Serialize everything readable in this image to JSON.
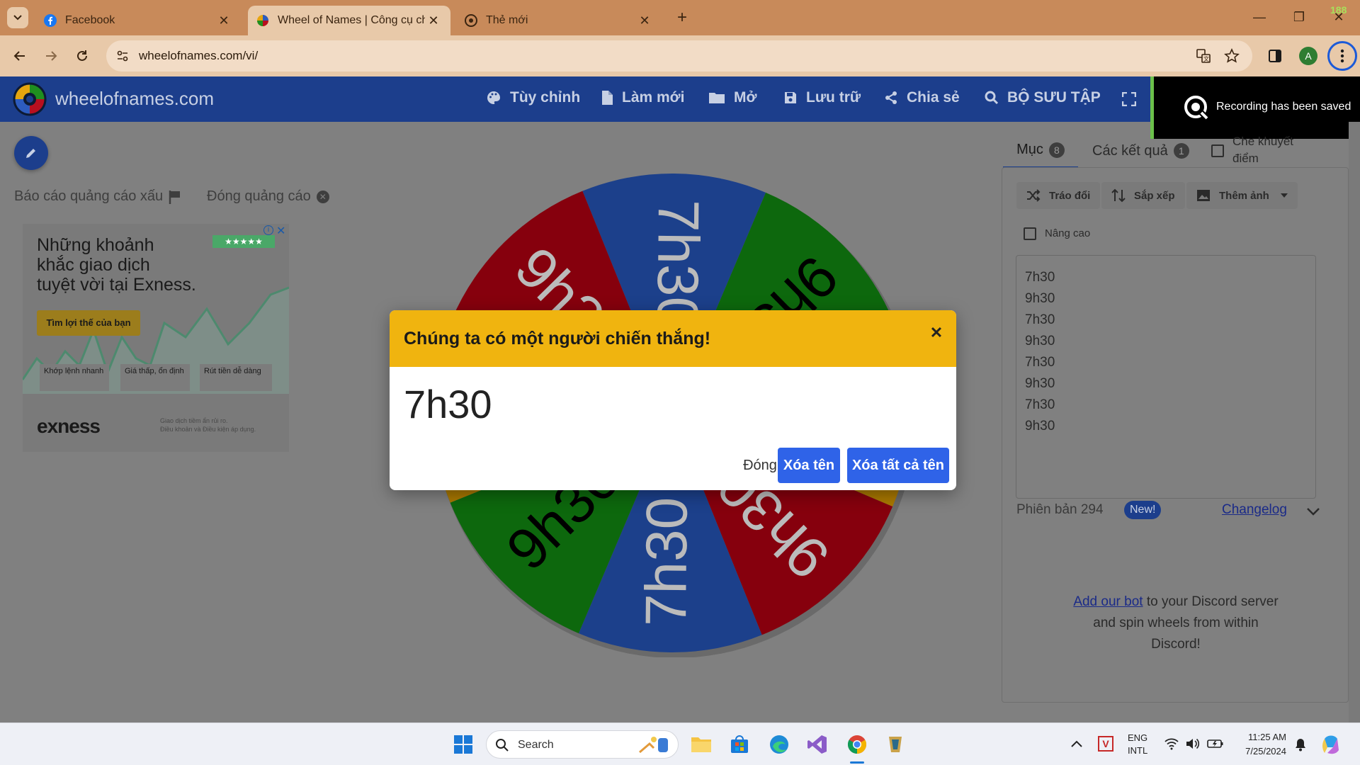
{
  "browser": {
    "tabs": [
      {
        "title": "Facebook"
      },
      {
        "title": "Wheel of Names | Công cụ chọn"
      },
      {
        "title": "Thẻ mới"
      }
    ],
    "url": "wheelofnames.com/vi/",
    "profile_initial": "A",
    "corner_badge": "188"
  },
  "site": {
    "logo_text": "wheelofnames.com",
    "menu": [
      {
        "label": "Tùy chỉnh",
        "icon": "palette-icon"
      },
      {
        "label": "Làm mới",
        "icon": "document-icon"
      },
      {
        "label": "Mở",
        "icon": "folder-icon"
      },
      {
        "label": "Lưu trữ",
        "icon": "save-icon"
      },
      {
        "label": "Chia sẻ",
        "icon": "share-icon"
      },
      {
        "label": "BỘ SƯU TẬP",
        "icon": "search-icon"
      }
    ]
  },
  "recording": {
    "text": "Recording has been saved"
  },
  "ad_bar": {
    "report": "Báo cáo quảng cáo xấu",
    "close": "Đóng quảng cáo"
  },
  "ad": {
    "headline_lines": [
      "Những khoảnh",
      "khắc giao dịch",
      "tuyệt vời tại Exness."
    ],
    "cta": "Tìm lợi thế của bạn",
    "features": [
      "Khớp lệnh nhanh",
      "Giá thấp, ổn định",
      "Rút tiền dễ dàng"
    ],
    "brand": "exness",
    "disclaimer_lines": [
      "Giao dịch tiềm ẩn rủi ro.",
      "Điều khoản và Điều kiện áp dụng."
    ]
  },
  "wheel": {
    "slices": [
      {
        "label": "7h30",
        "color": "#2d5cbf"
      },
      {
        "label": "9h30",
        "color": "#1f8f1f"
      },
      {
        "label": "7h30",
        "color": "#e6a50f"
      },
      {
        "label": "9h30",
        "color": "#b80f1f"
      },
      {
        "label": "7h30",
        "color": "#2d5cbf"
      },
      {
        "label": "9h30",
        "color": "#1f8f1f"
      },
      {
        "label": "7h30",
        "color": "#e6a50f"
      },
      {
        "label": "9h30",
        "color": "#b80f1f"
      }
    ]
  },
  "modal": {
    "title": "Chúng ta có một người chiến thắng!",
    "winner": "7h30",
    "close_label": "Đóng",
    "remove_label": "Xóa tên",
    "remove_all_label": "Xóa tất cả tên"
  },
  "panel": {
    "tab_entries": "Mục",
    "entries_count": "8",
    "tab_results": "Các kết quả",
    "results_count": "1",
    "hide_label_lines": [
      "Che khuyết",
      "điểm"
    ],
    "shuffle": "Tráo đổi",
    "sort": "Sắp xếp",
    "add_image": "Thêm ảnh",
    "advanced": "Nâng cao",
    "entries": [
      "7h30",
      "9h30",
      "7h30",
      "9h30",
      "7h30",
      "9h30",
      "7h30",
      "9h30"
    ],
    "version": "Phiên bản 294",
    "new_badge": "New!",
    "changelog": "Changelog",
    "discord_link": "Add our bot",
    "discord_text1": " to your Discord server",
    "discord_text2": "and spin wheels from within",
    "discord_text3": "Discord!"
  },
  "taskbar": {
    "search_placeholder": "Search",
    "lang1": "ENG",
    "lang2": "INTL",
    "time": "11:25 AM",
    "date": "7/25/2024"
  }
}
